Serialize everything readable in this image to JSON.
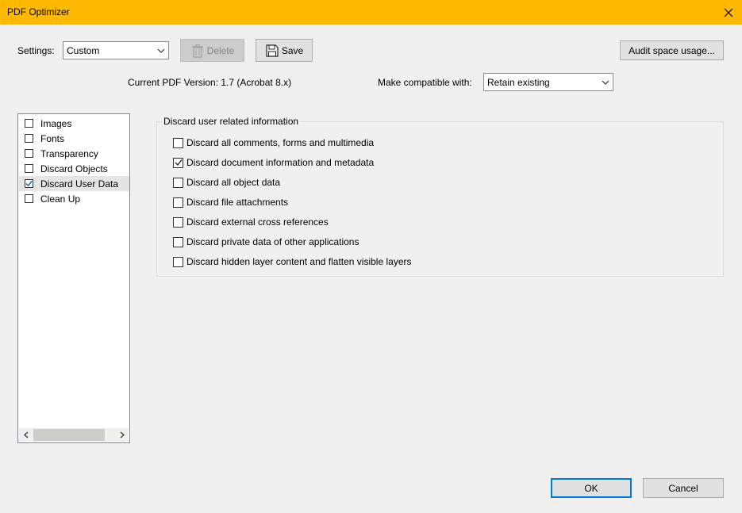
{
  "window": {
    "title": "PDF Optimizer"
  },
  "toolbar": {
    "settings_label": "Settings:",
    "settings_value": "Custom",
    "delete_label": "Delete",
    "save_label": "Save",
    "audit_label": "Audit space usage..."
  },
  "version": {
    "current_text": "Current PDF Version: 1.7 (Acrobat 8.x)",
    "compat_label": "Make compatible with:",
    "compat_value": "Retain existing"
  },
  "sidebar": {
    "items": [
      {
        "label": "Images",
        "checked": false
      },
      {
        "label": "Fonts",
        "checked": false
      },
      {
        "label": "Transparency",
        "checked": false
      },
      {
        "label": "Discard Objects",
        "checked": false
      },
      {
        "label": "Discard User Data",
        "checked": true,
        "selected": true
      },
      {
        "label": "Clean Up",
        "checked": false
      }
    ]
  },
  "panel": {
    "group_title": "Discard user related information",
    "options": [
      {
        "label": "Discard all comments, forms and multimedia",
        "checked": false
      },
      {
        "label": "Discard document information and metadata",
        "checked": true
      },
      {
        "label": "Discard all object data",
        "checked": false
      },
      {
        "label": "Discard file attachments",
        "checked": false
      },
      {
        "label": "Discard external cross references",
        "checked": false
      },
      {
        "label": "Discard private data of other applications",
        "checked": false
      },
      {
        "label": "Discard hidden layer content and flatten visible layers",
        "checked": false
      }
    ]
  },
  "footer": {
    "ok_label": "OK",
    "cancel_label": "Cancel"
  },
  "colors": {
    "titlebar": "#ffb900",
    "accent": "#0078d7"
  }
}
